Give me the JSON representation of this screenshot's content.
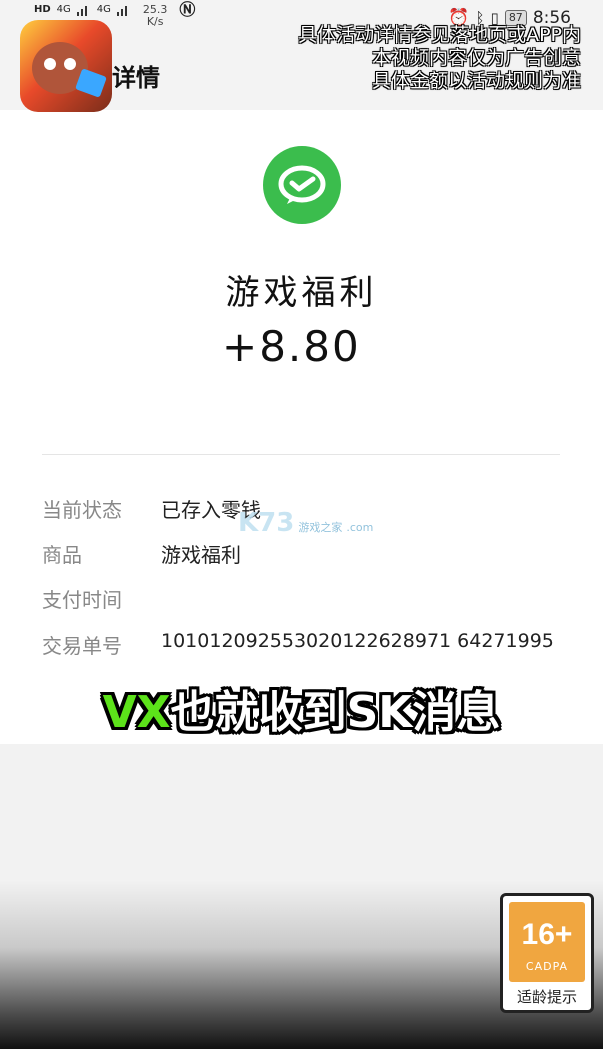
{
  "status_bar": {
    "left_labels": [
      "HD",
      "4G",
      "4G"
    ],
    "net_speed": "25.3",
    "net_speed_unit": "K/s",
    "battery": "87",
    "time": "8:56"
  },
  "header": {
    "title": "详情"
  },
  "ad_notice": [
    "具体活动详情参见落地页或APP内",
    "本视频内容仅为广告创意",
    "具体金额以活动规则为准"
  ],
  "transaction": {
    "merchant": "游戏福利",
    "amount": "+8.80",
    "rows": [
      {
        "key": "当前状态",
        "value": "已存入零钱"
      },
      {
        "key": "商品",
        "value": "游戏福利"
      },
      {
        "key": "支付时间",
        "value": ""
      },
      {
        "key": "交易单号",
        "value": "101012092553020122628971 64271995"
      }
    ]
  },
  "watermark": {
    "brand": "K73",
    "sub": "游戏之家",
    "domain": ".com"
  },
  "caption": {
    "highlight": "VX",
    "rest": "也就收到SK消息"
  },
  "age_rating": {
    "number": "16+",
    "org": "CADPA",
    "tip": "适龄提示"
  },
  "colors": {
    "wechat_green": "#3bbd4d",
    "caption_green": "#5ce21a",
    "age_orange": "#f0a640"
  }
}
